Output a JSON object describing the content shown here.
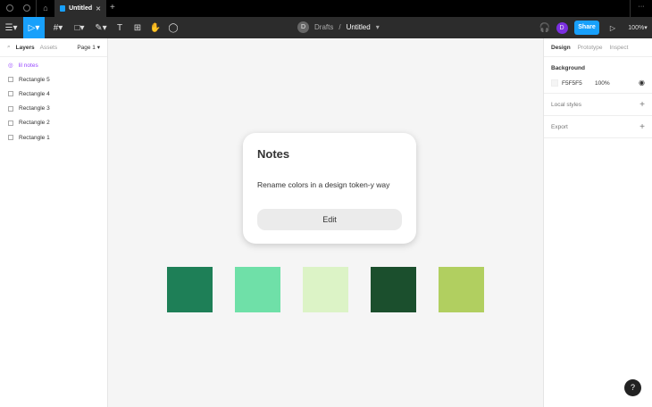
{
  "tabs": {
    "active": "Untitled"
  },
  "header": {
    "initial": "D",
    "folder": "Drafts",
    "sep": "/",
    "file": "Untitled",
    "share": "Share",
    "zoom": "100%",
    "user_initial": "D"
  },
  "left": {
    "tabs": [
      "Layers",
      "Assets"
    ],
    "page": "Page 1",
    "layers": [
      "lil notes",
      "Rectangle 5",
      "Rectangle 4",
      "Rectangle 3",
      "Rectangle 2",
      "Rectangle 1"
    ]
  },
  "right": {
    "tabs": [
      "Design",
      "Prototype",
      "Inspect"
    ],
    "background_label": "Background",
    "bg_hex": "F5F5F5",
    "bg_opacity": "100%",
    "local_styles": "Local styles",
    "export": "Export"
  },
  "card": {
    "title": "Notes",
    "body": "Rename colors in a design token-y way",
    "button": "Edit"
  },
  "swatches": [
    "#1e7f57",
    "#6fe0a8",
    "#dcf3c6",
    "#1b4f2d",
    "#b1cf60"
  ],
  "accent": "#18a0fb"
}
